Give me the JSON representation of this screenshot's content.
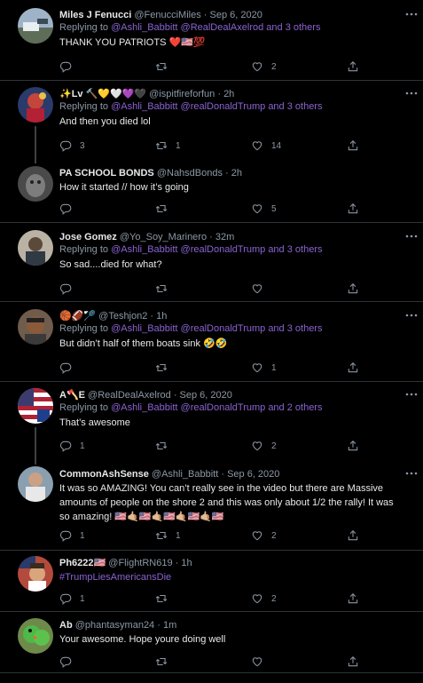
{
  "tweets": [
    {
      "name": "Miles J Fenucci",
      "handle": "@FenucciMiles",
      "time": "Sep 6, 2020",
      "replying_prefix": "Replying to ",
      "replying_mentions": "@Ashli_Babbitt @RealDealAxelrod and 3 others",
      "text": "THANK YOU PATRIOTS ❤️🇺🇸💯",
      "replies": "",
      "retweets": "",
      "likes": "2"
    },
    {
      "name": "✨Lv 🔨💛🤍💜🖤",
      "handle": "@ispitfireforfun",
      "time": "2h",
      "replying_prefix": "Replying to ",
      "replying_mentions": "@Ashli_Babbitt @realDonaldTrump and 3 others",
      "text": "And then you died lol",
      "replies": "3",
      "retweets": "1",
      "likes": "14"
    },
    {
      "name": "PA SCHOOL BONDS",
      "handle": "@NahsdBonds",
      "time": "2h",
      "text": "How it started // how it’s going",
      "replies": "",
      "retweets": "",
      "likes": "5"
    },
    {
      "name": "Jose Gomez",
      "handle": "@Yo_Soy_Marinero",
      "time": "32m",
      "replying_prefix": "Replying to ",
      "replying_mentions": "@Ashli_Babbitt @realDonaldTrump and 3 others",
      "text": "So sad....died for what?",
      "replies": "",
      "retweets": "",
      "likes": ""
    },
    {
      "name": "🏀🏈🏸",
      "handle": "@Teshjon2",
      "time": "1h",
      "replying_prefix": "Replying to ",
      "replying_mentions": "@Ashli_Babbitt @realDonaldTrump and 3 others",
      "text": "But didn’t half of them boats sink 🤣🤣",
      "replies": "",
      "retweets": "",
      "likes": "1"
    },
    {
      "name": "A🪓E",
      "handle": "@RealDealAxelrod",
      "time": "Sep 6, 2020",
      "replying_prefix": "Replying to ",
      "replying_mentions": "@Ashli_Babbitt @realDonaldTrump and 2 others",
      "text": "That’s awesome",
      "replies": "1",
      "retweets": "",
      "likes": "2"
    },
    {
      "name": "CommonAshSense",
      "handle": "@Ashli_Babbitt",
      "time": "Sep 6, 2020",
      "text": "It was so AMAZING!  You can’t really see in the video but there are Massive amounts of people on the shore 2 and this was only about 1/2 the rally!  It was so amazing! 🇺🇸🤙🏼🇺🇸🤙🏼🇺🇸🤙🏼🇺🇸🤙🏼🇺🇸",
      "replies": "1",
      "retweets": "1",
      "likes": "2"
    },
    {
      "name": "Ph6222🇺🇸",
      "handle": "@FlightRN619",
      "time": "1h",
      "text": "#TrumpLiesAmericansDie",
      "replies": "1",
      "retweets": "",
      "likes": "2"
    },
    {
      "name": "Ab",
      "handle": "@phantasyman24",
      "time": "1m",
      "text": "Your awesome. Hope youre doing well",
      "replies": "",
      "retweets": "",
      "likes": ""
    }
  ],
  "separator": " · ",
  "colors": {
    "background": "#000000",
    "link": "#8a63d2",
    "muted": "#8b98a5",
    "divider": "#2f3336"
  },
  "icons": [
    "reply-icon",
    "retweet-icon",
    "like-icon",
    "share-icon",
    "more-icon"
  ]
}
